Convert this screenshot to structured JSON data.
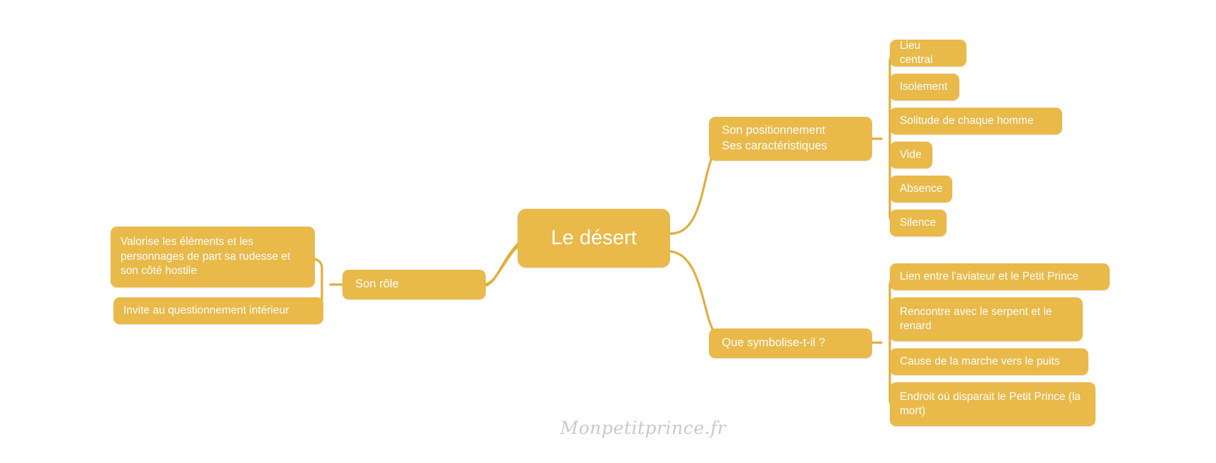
{
  "theme": {
    "node_fill": "#e9b949",
    "node_text": "#ffffff",
    "connector": "#e3ae3c",
    "background": "#ffffff",
    "watermark_color": "#c9c9c9"
  },
  "mindmap": {
    "root": {
      "label": "Le désert"
    },
    "branches": [
      {
        "id": "positionnement",
        "label": "Son positionnement\nSes caractéristiques",
        "side": "right",
        "children": [
          {
            "label": "Lieu central"
          },
          {
            "label": "Isolement"
          },
          {
            "label": "Solitude de chaque homme"
          },
          {
            "label": "Vide"
          },
          {
            "label": "Absence"
          },
          {
            "label": "Silence"
          }
        ]
      },
      {
        "id": "symbolise",
        "label": "Que symbolise-t-il ?",
        "side": "right",
        "children": [
          {
            "label": "Lien entre l'aviateur et le Petit Prince"
          },
          {
            "label": "Rencontre avec le serpent et le renard"
          },
          {
            "label": "Cause de la marche vers le puits"
          },
          {
            "label": "Endroit où disparait le Petit Prince (la mort)"
          }
        ]
      },
      {
        "id": "role",
        "label": "Son rôle",
        "side": "left",
        "children": [
          {
            "label": "Valorise les éléments et les personnages de part sa rudesse et son côté hostile"
          },
          {
            "label": "Invite au questionnement intérieur"
          }
        ]
      }
    ]
  },
  "watermark": {
    "label": "Monpetitprince.fr"
  }
}
